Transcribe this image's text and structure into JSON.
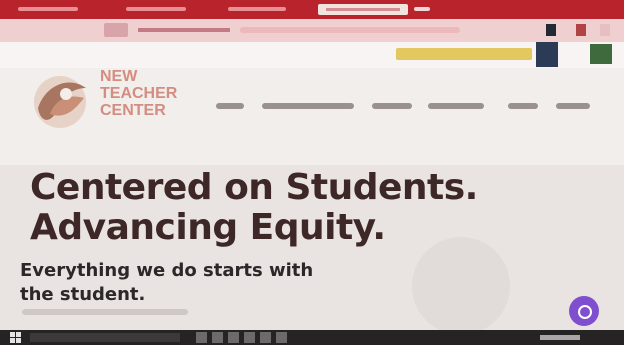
{
  "hero": {
    "line1": "Centered on Students.",
    "line2": "Advancing Equity.",
    "sub1": "Everything we do starts with",
    "sub2": "the student."
  },
  "colors": {
    "brand_red": "#b8232c",
    "headline": "#3d2727",
    "chat": "#7f4fd0"
  },
  "icons": [
    "chat-icon",
    "windows-start-icon"
  ]
}
